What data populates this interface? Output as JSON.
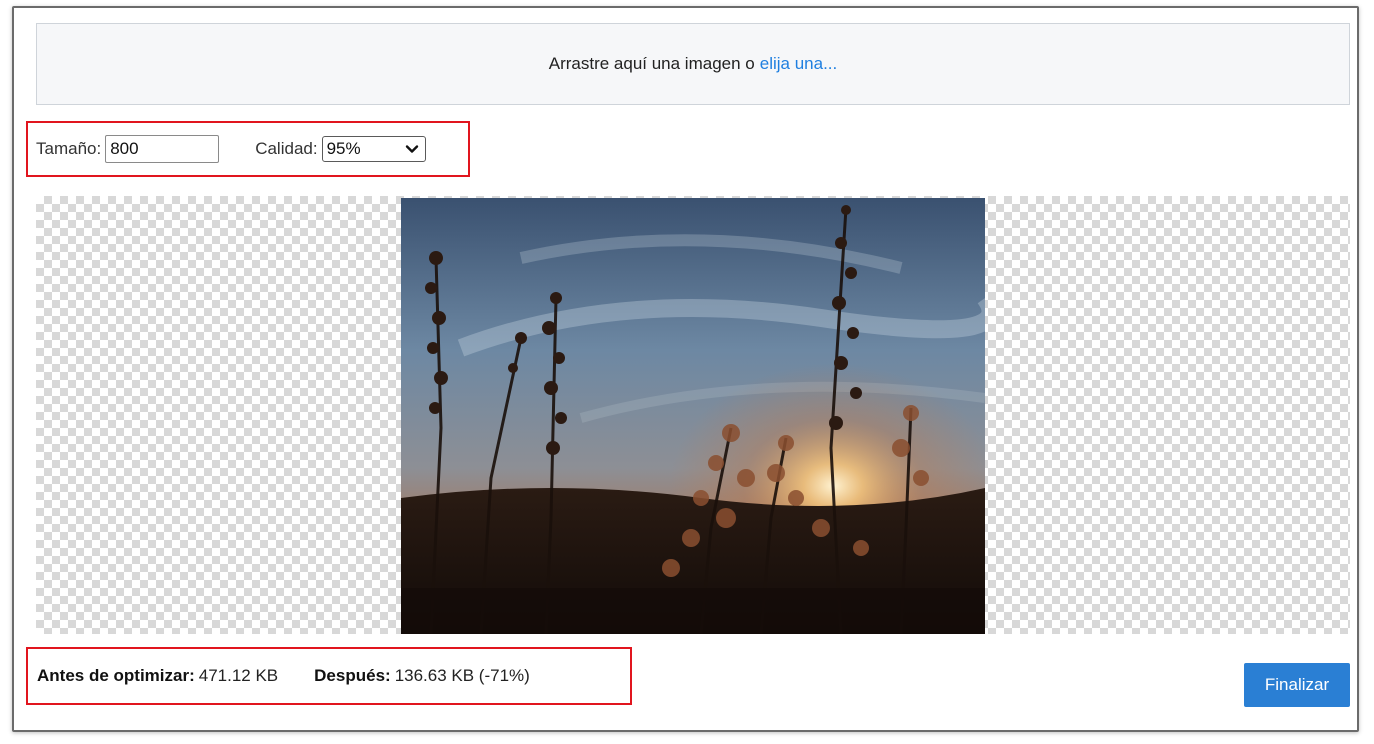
{
  "dropzone": {
    "text": "Arrastre aquí una imagen o",
    "link": "elija una..."
  },
  "settings": {
    "size_label": "Tamaño:",
    "size_value": "800",
    "quality_label": "Calidad:",
    "quality_selected": "95%"
  },
  "stats": {
    "before_label": "Antes de optimizar:",
    "before_value": "471.12 KB",
    "after_label": "Después:",
    "after_value": "136.63 KB (-71%)"
  },
  "actions": {
    "finish_label": "Finalizar"
  },
  "colors": {
    "accent": "#2a7fd4",
    "link": "#1f7fe0",
    "highlight": "#e1151e"
  },
  "icons": {
    "select_arrow": "chevron-down-icon"
  }
}
